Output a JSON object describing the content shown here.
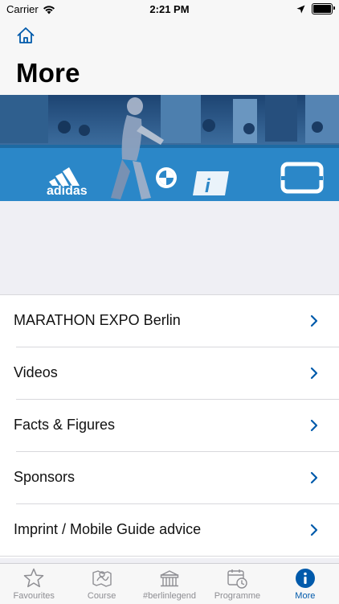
{
  "status_bar": {
    "carrier": "Carrier",
    "time": "2:21 PM"
  },
  "header": {
    "title": "More",
    "home_icon": "home-icon"
  },
  "hero": {
    "brands": [
      "adidas",
      "BMW",
      "Abbott"
    ]
  },
  "menu": {
    "items": [
      {
        "label": "MARATHON EXPO Berlin"
      },
      {
        "label": "Videos"
      },
      {
        "label": "Facts & Figures"
      },
      {
        "label": "Sponsors"
      },
      {
        "label": "Imprint / Mobile Guide advice"
      }
    ]
  },
  "tab_bar": {
    "tabs": [
      {
        "label": "Favourites",
        "icon": "star-icon"
      },
      {
        "label": "Course",
        "icon": "map-icon"
      },
      {
        "label": "#berlinlegend",
        "icon": "gate-icon"
      },
      {
        "label": "Programme",
        "icon": "calendar-clock-icon"
      },
      {
        "label": "More",
        "icon": "info-icon",
        "active": true
      }
    ]
  },
  "colors": {
    "accent": "#005aab",
    "inactive": "#8e8e93",
    "background": "#efeff4",
    "banner_blue": "#2a82c7"
  }
}
